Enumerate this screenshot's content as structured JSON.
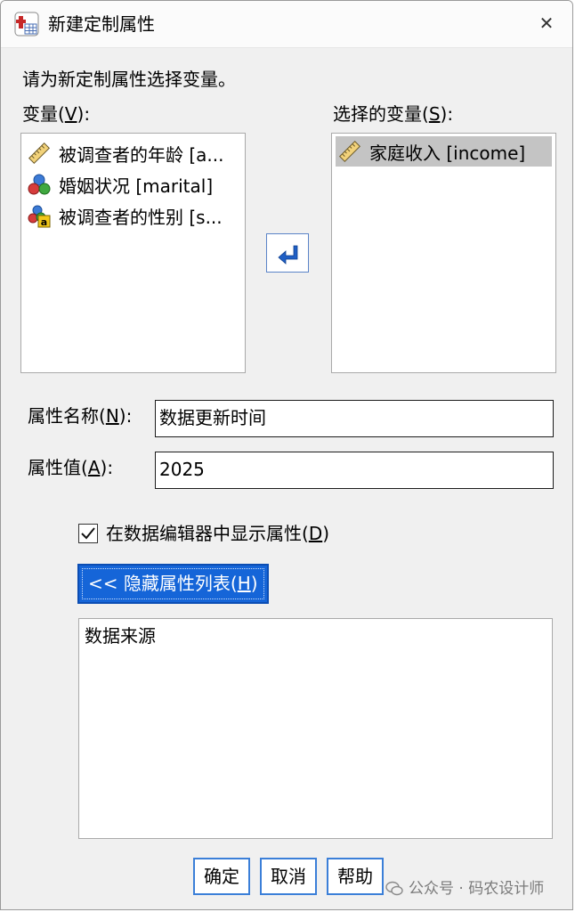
{
  "window": {
    "title": "新建定制属性",
    "close_icon": "close-icon"
  },
  "instruction": "请为新定制属性选择变量。",
  "variables": {
    "label": "变量",
    "mnemonic": "V",
    "colon": ":",
    "items": [
      {
        "icon": "scale-ruler-icon",
        "label": "被调查者的年龄 [a..."
      },
      {
        "icon": "nominal-circles-icon",
        "label": "婚姻状况 [marital]"
      },
      {
        "icon": "nominal-string-icon",
        "label": "被调查者的性别 [s..."
      }
    ]
  },
  "selected": {
    "label": "选择的变量",
    "mnemonic": "S",
    "colon": ":",
    "items": [
      {
        "icon": "scale-ruler-icon",
        "label": "家庭收入 [income]"
      }
    ]
  },
  "move_button_icon": "arrow-left-icon",
  "attribute_name": {
    "label": "属性名称",
    "mnemonic": "N",
    "colon": ":",
    "value": "数据更新时间"
  },
  "attribute_value": {
    "label": "属性值",
    "mnemonic": "A",
    "colon": ":",
    "value": "2025"
  },
  "show_in_editor": {
    "checked": true,
    "label": "在数据编辑器中显示属性",
    "mnemonic": "D"
  },
  "hide_list_button": {
    "label": "<< 隐藏属性列表",
    "mnemonic": "H"
  },
  "attribute_list": [
    "数据来源"
  ],
  "buttons": {
    "ok": "确定",
    "cancel": "取消",
    "help": "帮助"
  },
  "watermark": "公众号 · 码农设计师"
}
